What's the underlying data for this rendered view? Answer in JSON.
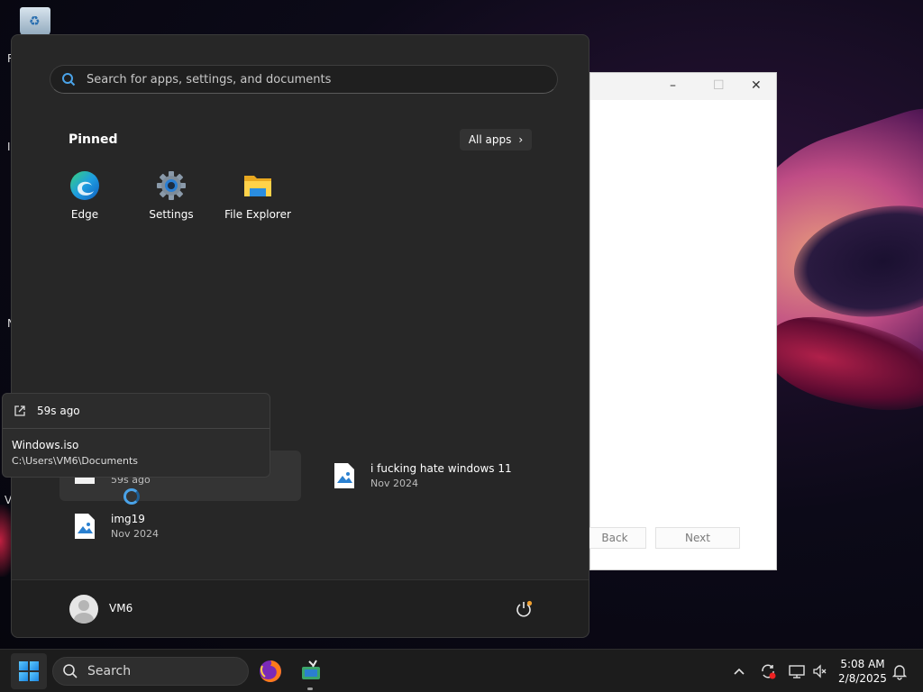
{
  "start_menu": {
    "search": {
      "placeholder": "Search for apps, settings, and documents"
    },
    "pinned": {
      "title": "Pinned",
      "all_apps_label": "All apps",
      "apps": [
        {
          "label": "Edge",
          "icon": "edge-icon"
        },
        {
          "label": "Settings",
          "icon": "settings-gear-icon"
        },
        {
          "label": "File Explorer",
          "icon": "folder-icon"
        }
      ]
    },
    "recommended": [
      {
        "name": "",
        "time": "59s ago",
        "icon": "blank-file-icon"
      },
      {
        "name": "i fucking hate windows 11",
        "time": "Nov 2024",
        "icon": "image-file-icon"
      },
      {
        "name": "img19",
        "time": "Nov 2024",
        "icon": "image-file-icon"
      }
    ],
    "user": {
      "name": "VM6"
    }
  },
  "tooltip": {
    "time": "59s ago",
    "file_name": "Windows.iso",
    "path": "C:\\Users\\VM6\\Documents"
  },
  "background_window": {
    "back_label": "Back",
    "next_label": "Next"
  },
  "desktop": {
    "letters": [
      "R",
      "I",
      "N",
      "V"
    ]
  },
  "taskbar": {
    "search_label": "Search",
    "time": "5:08 AM",
    "date": "2/8/2025"
  },
  "colors": {
    "accent": "#4aa3e8",
    "start_bg": "#272727",
    "taskbar_bg": "#1c1c1c"
  }
}
